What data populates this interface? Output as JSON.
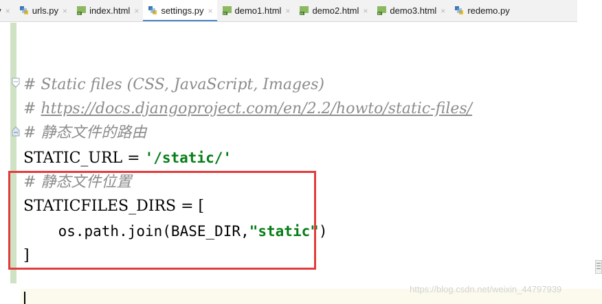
{
  "tabs": [
    {
      "label": "py",
      "type": "python",
      "active": false
    },
    {
      "label": "urls.py",
      "type": "python",
      "active": false
    },
    {
      "label": "index.html",
      "type": "html",
      "active": false
    },
    {
      "label": "settings.py",
      "type": "python",
      "active": true
    },
    {
      "label": "demo1.html",
      "type": "html",
      "active": false
    },
    {
      "label": "demo2.html",
      "type": "html",
      "active": false
    },
    {
      "label": "demo3.html",
      "type": "html",
      "active": false
    },
    {
      "label": "redemo.py",
      "type": "python",
      "active": false
    }
  ],
  "tab_close_glyph": "×",
  "code": {
    "line1": "# Static files (CSS, JavaScript, Images)",
    "line2_prefix": "# ",
    "line2_link": "https://docs.djangoproject.com/en/2.2/howto/static-files/",
    "line3": "# 静态文件的路由",
    "line4_name": "STATIC_URL = ",
    "line4_value": "'/static/'",
    "line5": "# 静态文件位置",
    "line6": "STATICFILES_DIRS = [",
    "line7_call": "    os.path.join(BASE_DIR,",
    "line7_value": "\"static\"",
    "line7_end": ")",
    "line8": "]"
  },
  "watermark": "https://blog.csdn.net/weixin_44797939",
  "colors": {
    "comment": "#8c8c8c",
    "string": "#067d17",
    "highlight_box": "#e23b3b",
    "active_tab_underline": "#4a88c7",
    "gutter_changed": "#cfe3c4"
  }
}
